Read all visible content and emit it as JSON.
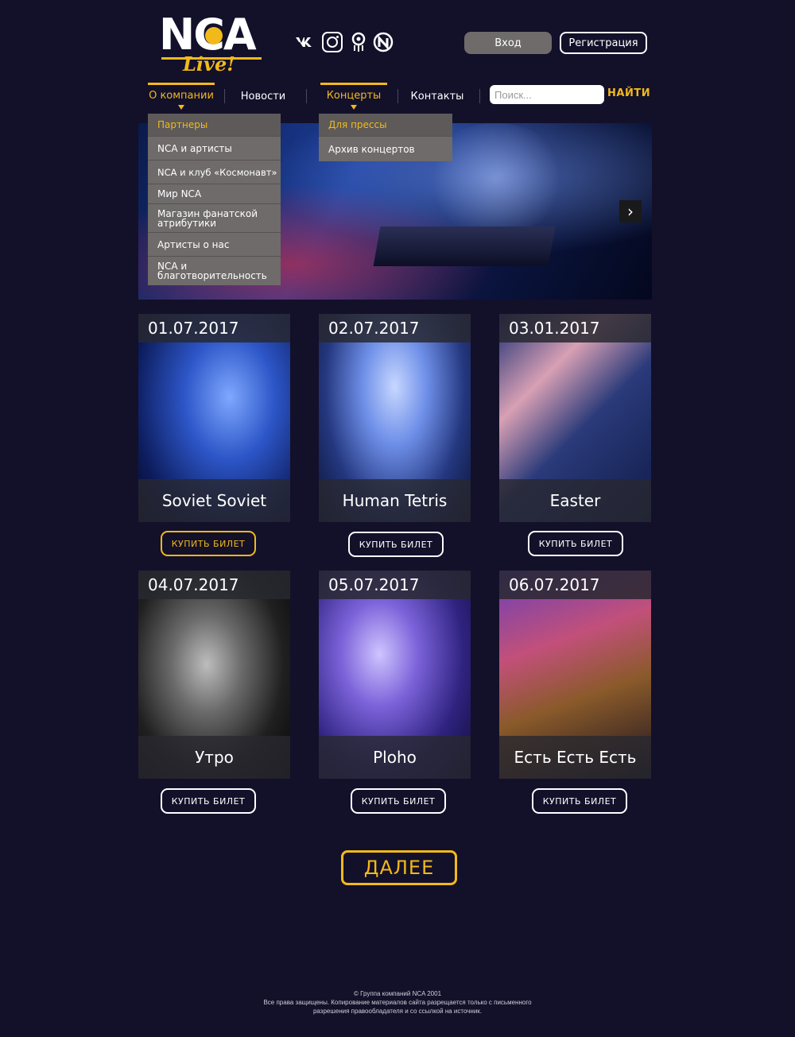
{
  "logo": {
    "brand": "NCA",
    "sub": "Live!"
  },
  "social": {
    "vk": "vk"
  },
  "auth": {
    "login": "Вход",
    "register": "Регистрация"
  },
  "nav": {
    "items": [
      "О компании",
      "Новости",
      "Концерты",
      "Контакты"
    ],
    "search_placeholder": "Поиск...",
    "search_button": "НАЙТИ"
  },
  "dropdown_company": [
    "Партнеры",
    "NCA и артисты",
    "NCA и клуб «Космонавт»",
    "Мир NCA",
    "Магазин фанатской атрибутики",
    "Артисты о нас",
    "NCA и благотворительность"
  ],
  "dropdown_concerts": [
    "Для прессы",
    "Архив концертов"
  ],
  "hero": {
    "next": "›"
  },
  "concerts": [
    {
      "date": "01.07.2017",
      "name": "Soviet Soviet",
      "buy": "КУПИТЬ БИЛЕТ"
    },
    {
      "date": "02.07.2017",
      "name": "Human Tetris",
      "buy": "КУПИТЬ БИЛЕТ"
    },
    {
      "date": "03.01.2017",
      "name": "Easter",
      "buy": "КУПИТЬ БИЛЕТ"
    },
    {
      "date": "04.07.2017",
      "name": "Утро",
      "buy": "КУПИТЬ БИЛЕТ"
    },
    {
      "date": "05.07.2017",
      "name": "Ploho",
      "buy": "КУПИТЬ БИЛЕТ"
    },
    {
      "date": "06.07.2017",
      "name": "Есть Есть Есть",
      "buy": "КУПИТЬ БИЛЕТ"
    }
  ],
  "more": "ДАЛЕЕ",
  "footer": {
    "line1": "© Группа компаний NCA 2001",
    "line2": "Все права защищены. Копирование материалов сайта разрещается только с письменного",
    "line3": "разрешения правообладателя и со ссылкой на источник."
  },
  "colors": {
    "background": "#13102a",
    "accent": "#f2b91a",
    "dropdown": "#6e6b6a"
  }
}
